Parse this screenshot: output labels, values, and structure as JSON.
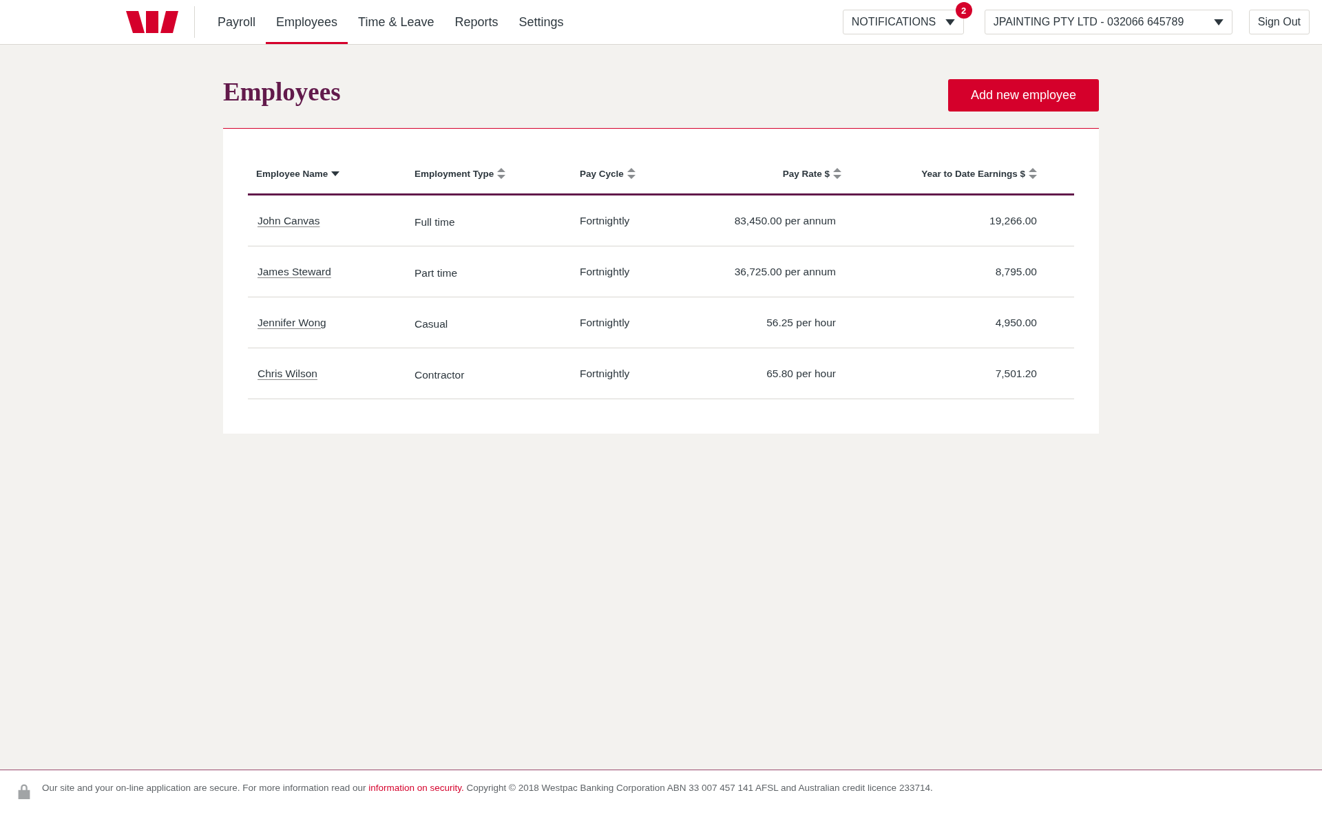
{
  "nav": {
    "items": [
      {
        "label": "Payroll",
        "selected": false
      },
      {
        "label": "Employees",
        "selected": true
      },
      {
        "label": "Time & Leave",
        "selected": false
      },
      {
        "label": "Reports",
        "selected": false
      },
      {
        "label": "Settings",
        "selected": false
      }
    ]
  },
  "notifications": {
    "label": "NOTIFICATIONS",
    "badge": "2"
  },
  "account": {
    "label": "JPAINTING PTY LTD - 032066 645789"
  },
  "sign_out": "Sign Out",
  "page": {
    "title": "Employees",
    "add_button": "Add new employee"
  },
  "table": {
    "columns": [
      {
        "label": "Employee Name",
        "kind": "text",
        "sorted": true
      },
      {
        "label": "Employment Type",
        "kind": "text",
        "sorted": false
      },
      {
        "label": "Pay Cycle",
        "kind": "text",
        "sorted": false
      },
      {
        "label": "Pay Rate $",
        "kind": "amount",
        "sorted": false
      },
      {
        "label": "Year to Date Earnings $",
        "kind": "amount",
        "sorted": false
      }
    ],
    "rows": [
      [
        "John Canvas",
        "Full time",
        "Fortnightly",
        "83,450.00 per annum",
        "19,266.00"
      ],
      [
        "James Steward",
        "Part time",
        "Fortnightly",
        "36,725.00 per annum",
        "8,795.00"
      ],
      [
        "Jennifer Wong",
        "Casual",
        "Fortnightly",
        "56.25 per hour",
        "4,950.00"
      ],
      [
        "Chris Wilson",
        "Contractor",
        "Fortnightly",
        "65.80 per hour",
        "7,501.20"
      ]
    ]
  },
  "footer": {
    "text_before": "Our site and your on-line application are secure. For more information read our ",
    "link": "information on security.",
    "text_after": " Copyright © 2018 Westpac Banking Corporation ABN 33 007 457 141 AFSL and Australian credit licence 233714."
  }
}
